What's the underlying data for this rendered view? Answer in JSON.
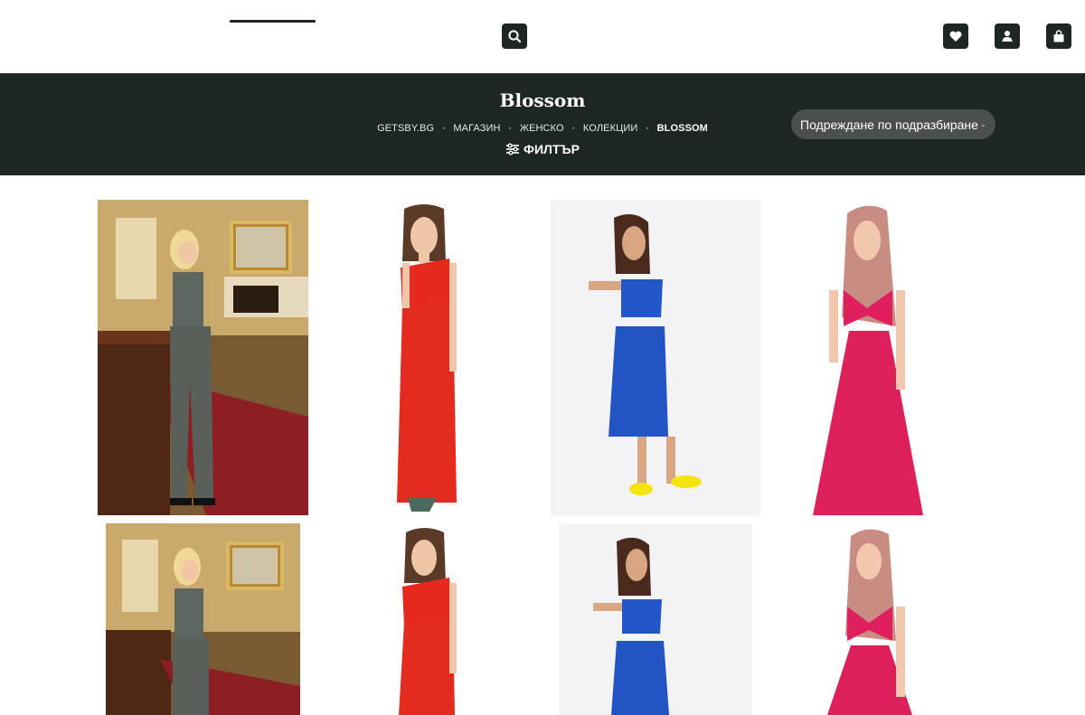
{
  "header": {
    "search_icon": "search-icon",
    "wishlist_icon": "heart-icon",
    "account_icon": "user-icon",
    "cart_icon": "shopping-bag-icon"
  },
  "banner": {
    "title": "Blossom",
    "breadcrumb": [
      "GETSBY.BG",
      "МАГАЗИН",
      "ЖЕНСКО",
      "КОЛЕКЦИИ",
      "BLOSSOM"
    ],
    "filter_label": "ФИЛТЪР",
    "sort_value": "Подреждане по подразбиране"
  },
  "products": [
    {
      "name": "sequin two-piece"
    },
    {
      "name": "red one-shoulder dress"
    },
    {
      "name": "blue leather two-piece"
    },
    {
      "name": "pink bow dress"
    },
    {
      "name": "sequin two-piece"
    },
    {
      "name": "red one-shoulder dress"
    },
    {
      "name": "blue leather two-piece"
    },
    {
      "name": "pink bow dress"
    }
  ],
  "colors": {
    "brand_dark": "#1e2621",
    "sort_bg": "#4a514c"
  }
}
